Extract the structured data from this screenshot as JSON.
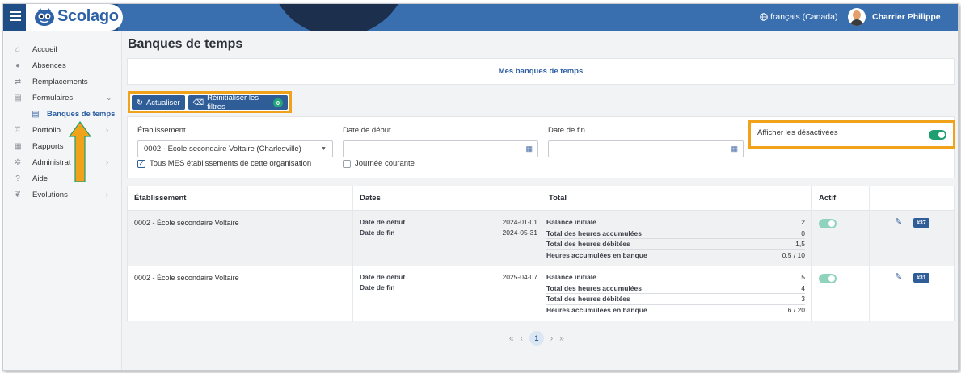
{
  "app": {
    "brand": "Scolago"
  },
  "header": {
    "language": "français (Canada)",
    "user_name": "Charrier Philippe"
  },
  "sidebar": {
    "items": [
      {
        "label": "Accueil",
        "icon": "home-icon"
      },
      {
        "label": "Absences",
        "icon": "person-icon"
      },
      {
        "label": "Remplacements",
        "icon": "swap-icon"
      },
      {
        "label": "Formulaires",
        "icon": "form-icon",
        "expanded": true
      },
      {
        "label": "Banques de temps",
        "icon": "document-icon",
        "sub": true,
        "active": true
      },
      {
        "label": "Portfolio",
        "icon": "trophy-icon"
      },
      {
        "label": "Rapports",
        "icon": "report-icon"
      },
      {
        "label": "Administrat",
        "icon": "gear-icon"
      },
      {
        "label": "Aide",
        "icon": "help-icon"
      },
      {
        "label": "Évolutions",
        "icon": "sprout-icon"
      }
    ]
  },
  "page": {
    "title": "Banques de temps",
    "tab_label": "Mes banques de temps"
  },
  "toolbar": {
    "refresh_label": "Actualiser",
    "reset_label": "Réinitialiser les filtres",
    "reset_count": "0"
  },
  "filters": {
    "establishment_label": "Établissement",
    "establishment_value": "0002 - École secondaire Voltaire (Charlesville)",
    "all_establishments_label": "Tous MES établissements de cette organisation",
    "start_label": "Date de début",
    "start_value": "",
    "current_day_label": "Journée courante",
    "end_label": "Date de fin",
    "end_value": "",
    "show_disabled_label": "Afficher les désactivées",
    "show_disabled_on": true
  },
  "table": {
    "columns": [
      "Établissement",
      "Dates",
      "Total",
      "Actif",
      ""
    ],
    "rows": [
      {
        "establishment": "0002 - École secondaire Voltaire",
        "start_label": "Date de début",
        "start": "2024-01-01",
        "end_label": "Date de fin",
        "end": "2024-05-31",
        "totals": [
          {
            "label": "Balance initiale",
            "value": "2"
          },
          {
            "label": "Total des heures accumulées",
            "value": "0"
          },
          {
            "label": "Total des heures débitées",
            "value": "1,5"
          },
          {
            "label": "Heures accumulées en banque",
            "value": "0,5 / 10"
          }
        ],
        "active": true,
        "id_badge": "#37"
      },
      {
        "establishment": "0002 - École secondaire Voltaire",
        "start_label": "Date de début",
        "start": "2025-04-07",
        "end_label": "Date de fin",
        "end": "",
        "totals": [
          {
            "label": "Balance initiale",
            "value": "5"
          },
          {
            "label": "Total des heures accumulées",
            "value": "4"
          },
          {
            "label": "Total des heures débitées",
            "value": "3"
          },
          {
            "label": "Heures accumulées en banque",
            "value": "6 / 20"
          }
        ],
        "active": true,
        "id_badge": "#31"
      }
    ]
  },
  "pagination": {
    "first": "«",
    "prev": "‹",
    "current": "1",
    "next": "›",
    "last": "»"
  },
  "colors": {
    "accent": "#2e5d98",
    "highlight": "#f0a21b",
    "toggle_on": "#1f9e6f"
  }
}
